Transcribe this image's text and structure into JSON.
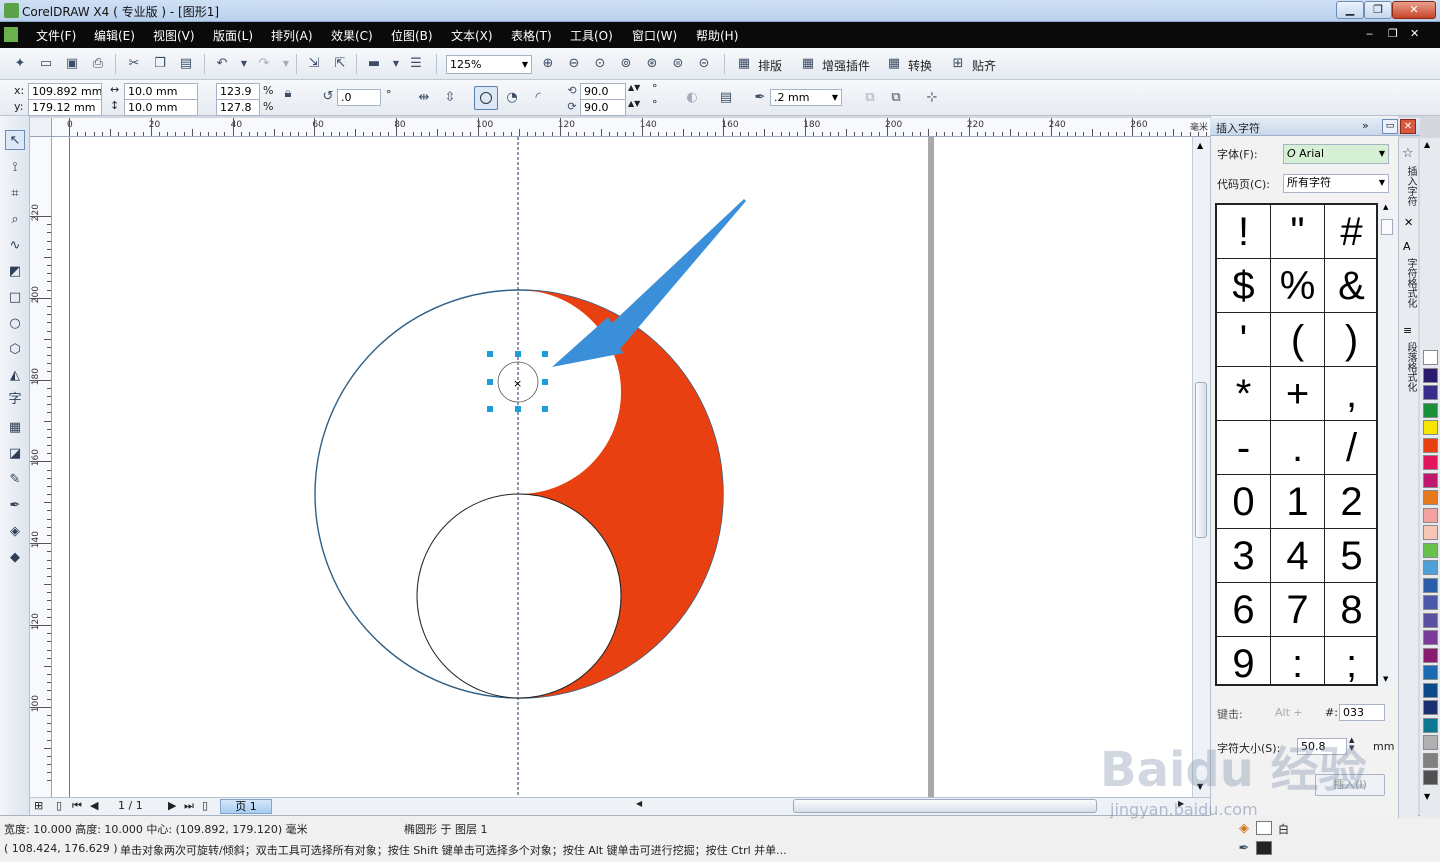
{
  "app": {
    "title": "CorelDRAW X4 ( 专业版 ) - [图形1]",
    "window_controls": [
      "▁",
      "❐",
      "✕"
    ],
    "doc_controls": [
      "‒",
      "❐",
      "✕"
    ]
  },
  "menu": [
    "文件(F)",
    "编辑(E)",
    "视图(V)",
    "版面(L)",
    "排列(A)",
    "效果(C)",
    "位图(B)",
    "文本(X)",
    "表格(T)",
    "工具(O)",
    "窗口(W)",
    "帮助(H)"
  ],
  "toolbar": {
    "zoom": "125%",
    "plugins": [
      "排版",
      "增强插件",
      "转换",
      "贴齐"
    ]
  },
  "property_bar": {
    "x": "109.892 mm",
    "y": "179.12 mm",
    "width": "10.0 mm",
    "height": "10.0 mm",
    "scale_x": "123.9",
    "scale_y": "127.8",
    "percent": "%",
    "rotation": ".0",
    "degree": "°",
    "start_angle": "90.0",
    "end_angle": "90.0",
    "outline_width": ".2 mm"
  },
  "rulers": {
    "horizontal": [
      "0",
      "20",
      "40",
      "60",
      "80",
      "100",
      "120",
      "140",
      "160",
      "180",
      "200",
      "220",
      "240",
      "260"
    ],
    "horizontal_unit": "毫米",
    "vertical": [
      "220",
      "200",
      "180",
      "160",
      "140",
      "120",
      "100"
    ]
  },
  "page_nav": {
    "counter": "1 / 1",
    "page_tab": "页 1"
  },
  "status": {
    "dimensions": "宽度: 10.000  高度: 10.000  中心: (109.892, 179.120)  毫米",
    "object_info": "椭圆形 于 图层 1",
    "cursor": "( 108.424, 176.629 )",
    "hint": "单击对象两次可旋转/倾斜；双击工具可选择所有对象；按住 Shift 键单击可选择多个对象；按住 Alt 键单击可进行挖掘；按住 Ctrl 并单...",
    "fill_label": "白"
  },
  "docker": {
    "title": "插入字符",
    "font_label": "字体(F):",
    "font_value": "Arial",
    "codepage_label": "代码页(C):",
    "codepage_value": "所有字符",
    "chars": [
      "!",
      "\"",
      "#",
      "$",
      "%",
      "&",
      "'",
      "(",
      ")",
      "*",
      "+",
      ",",
      "-",
      ".",
      "/",
      "0",
      "1",
      "2",
      "3",
      "4",
      "5",
      "6",
      "7",
      "8",
      "9",
      ":",
      ";"
    ],
    "keystroke_label": "键击:",
    "keystroke_value": "Alt +",
    "code_label": "#:",
    "code_value": "033",
    "size_label": "字符大小(S):",
    "size_value": "50.8",
    "size_unit": "mm",
    "insert_button": "插入(I)"
  },
  "side_tabs": [
    "插入字符",
    "字符格式化",
    "段落格式化"
  ],
  "palette": [
    "#ffffff",
    "#2b1a6e",
    "#3a2c8c",
    "#1a8f3a",
    "#f7e400",
    "#e84010",
    "#e2145a",
    "#c0186c",
    "#e8781c",
    "#f4a2a0",
    "#f6c7b4",
    "#6ac04c",
    "#4ea0d8",
    "#2a5ca8",
    "#4a5aa8",
    "#5a4fa0",
    "#7a3c98",
    "#8a1c70",
    "#1a6ab4",
    "#0a4a8c",
    "#1a3070",
    "#0a7890",
    "#b0b0b0",
    "#808080",
    "#505050"
  ],
  "colors": {
    "yin_fill": "#e84010",
    "selection": "#1e9ed8",
    "arrow": "#3b8fd8"
  },
  "watermark": {
    "main": "Baidu 经验",
    "sub": "jingyan.baidu.com"
  }
}
